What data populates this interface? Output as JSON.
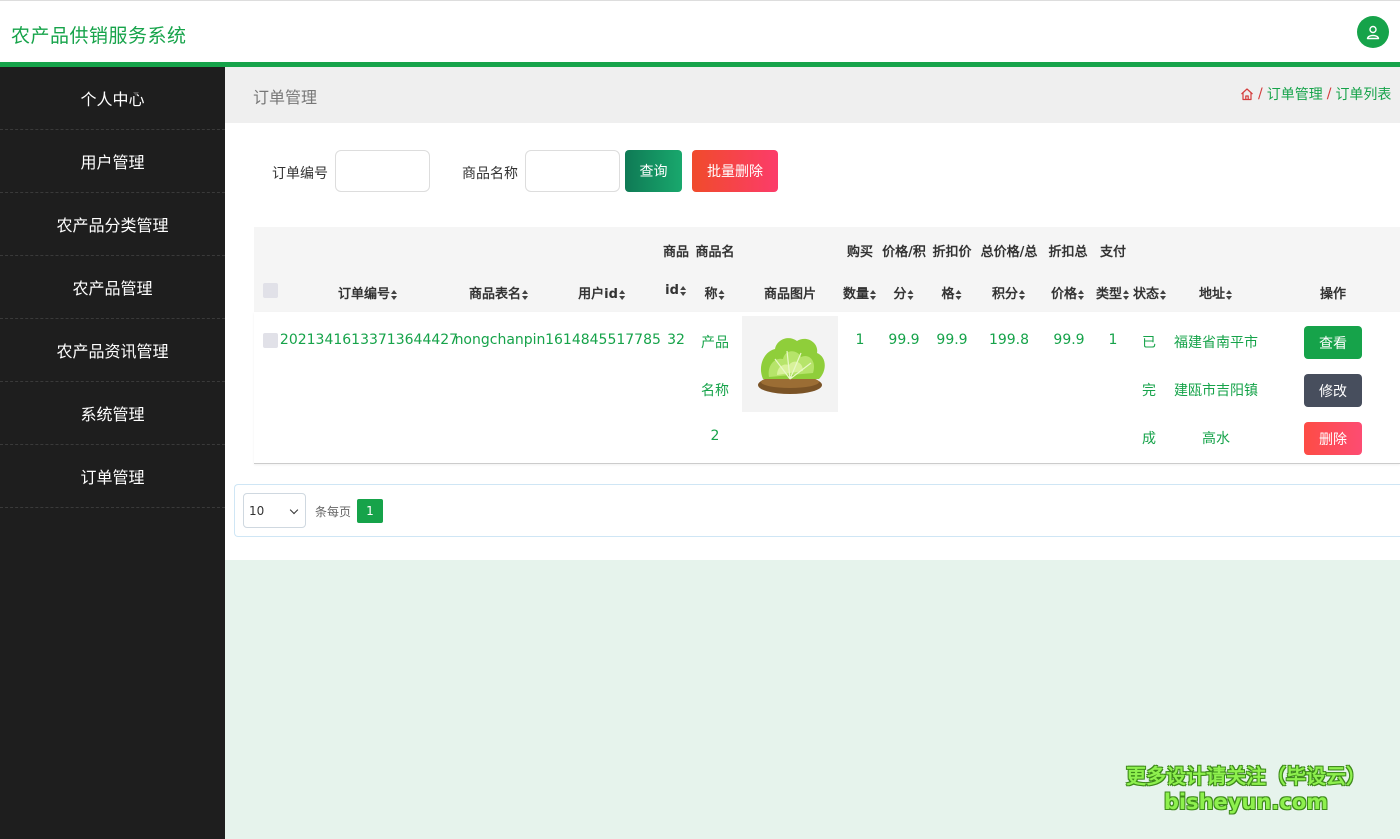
{
  "app": {
    "title": "农产品供销服务系统"
  },
  "colors": {
    "brand": "#16a34a",
    "sidebar_bg": "#1e1e1e",
    "danger": "#fd4c5c",
    "edit": "#474e5d"
  },
  "header": {
    "user_icon": "user-icon"
  },
  "sidebar": {
    "items": [
      {
        "label": "个人中心"
      },
      {
        "label": "用户管理"
      },
      {
        "label": "农产品分类管理"
      },
      {
        "label": "农产品管理"
      },
      {
        "label": "农产品资讯管理"
      },
      {
        "label": "系统管理"
      },
      {
        "label": "订单管理"
      }
    ]
  },
  "page": {
    "title": "订单管理",
    "breadcrumb": {
      "home_icon": "home-icon",
      "sep": "/",
      "items": [
        "订单管理",
        "订单列表"
      ]
    }
  },
  "search": {
    "order_no_label": "订单编号",
    "order_no_value": "",
    "goods_name_label": "商品名称",
    "goods_name_value": "",
    "query_label": "查询",
    "batch_delete_label": "批量删除"
  },
  "table": {
    "headers": {
      "order_no": "订单编号",
      "goods_table": "商品表名",
      "user_id": "用户id",
      "goods_id_l1": "商品",
      "goods_id_l2": "id",
      "goods_name_l1": "商品名",
      "goods_name_l2": "称",
      "goods_image": "商品图片",
      "qty_l1": "购买",
      "qty_l2": "数量",
      "price_l1": "价格/积",
      "price_l2": "分",
      "discount_l1": "折扣价",
      "discount_l2": "格",
      "total_l1": "总价格/总",
      "total_l2": "积分",
      "dtotal_l1": "折扣总",
      "dtotal_l2": "价格",
      "paytype_l1": "支付",
      "paytype_l2": "类型",
      "status": "状态",
      "address": "地址",
      "actions": "操作"
    },
    "rows": [
      {
        "order_no": "20213416133713644427",
        "goods_table": "nongchanpin",
        "user_id": "1614845517785",
        "goods_id": "32",
        "goods_name": [
          "产品",
          "名称",
          "2"
        ],
        "qty": "1",
        "price": "99.9",
        "discount": "99.9",
        "total": "199.8",
        "dtotal": "99.9",
        "paytype": "1",
        "status": [
          "已",
          "完",
          "成"
        ],
        "address": [
          "福建省南平市",
          "建瓯市吉阳镇",
          "高水"
        ],
        "view_label": "查看",
        "edit_label": "修改",
        "delete_label": "删除"
      }
    ]
  },
  "pagination": {
    "page_size": "10",
    "per_page_label": "条每页",
    "current_page": "1"
  },
  "watermark": {
    "line1": "更多设计请关注（毕设云）",
    "line2": "bisheyun.com"
  }
}
